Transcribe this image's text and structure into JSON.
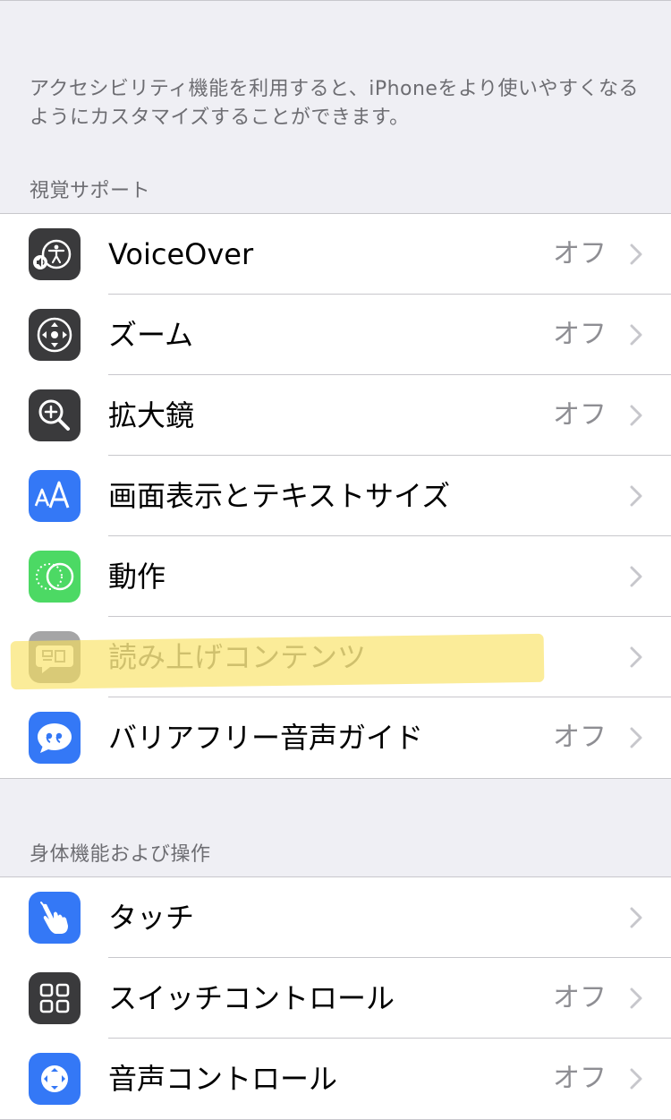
{
  "intro_text": "アクセシビリティ機能を利用すると、iPhoneをより使いやすくなるようにカスタマイズすることができます。",
  "sections": [
    {
      "header": "視覚サポート",
      "items": [
        {
          "label": "VoiceOver",
          "value": "オフ",
          "icon": "voiceover-icon",
          "icon_color": "#3a3a3c"
        },
        {
          "label": "ズーム",
          "value": "オフ",
          "icon": "zoom-icon",
          "icon_color": "#3a3a3c"
        },
        {
          "label": "拡大鏡",
          "value": "オフ",
          "icon": "magnifier-icon",
          "icon_color": "#3a3a3c"
        },
        {
          "label": "画面表示とテキストサイズ",
          "value": "",
          "icon": "display-text-size-icon",
          "icon_color": "#3478f6"
        },
        {
          "label": "動作",
          "value": "",
          "icon": "motion-icon",
          "icon_color": "#4cd964"
        },
        {
          "label": "読み上げコンテンツ",
          "value": "",
          "icon": "spoken-content-icon",
          "icon_color": "#3a3a3c"
        },
        {
          "label": "バリアフリー音声ガイド",
          "value": "オフ",
          "icon": "audio-descriptions-icon",
          "icon_color": "#3478f6"
        }
      ]
    },
    {
      "header": "身体機能および操作",
      "items": [
        {
          "label": "タッチ",
          "value": "",
          "icon": "touch-icon",
          "icon_color": "#3478f6"
        },
        {
          "label": "スイッチコントロール",
          "value": "オフ",
          "icon": "switch-control-icon",
          "icon_color": "#3a3a3c"
        },
        {
          "label": "音声コントロール",
          "value": "オフ",
          "icon": "voice-control-icon",
          "icon_color": "#3478f6"
        }
      ]
    }
  ],
  "colors": {
    "background": "#efeff4",
    "secondary_text": "#6d6d72",
    "value_text": "#8e8e93",
    "separator": "#c8c7cc",
    "highlight": "#f9e05a"
  }
}
